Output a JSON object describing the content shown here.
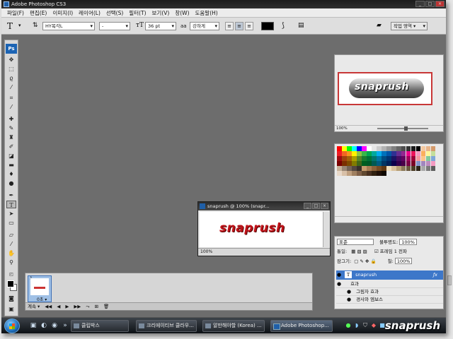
{
  "window": {
    "title": "Adobe Photoshop CS3",
    "controls": [
      "_",
      "□",
      "×"
    ]
  },
  "menu": [
    "파일(F)",
    "편집(E)",
    "이미지(I)",
    "레이어(L)",
    "선택(S)",
    "필터(T)",
    "보기(V)",
    "창(W)",
    "도움말(H)"
  ],
  "options": {
    "tool_glyph": "T",
    "font_family": "HY목각L",
    "font_style": "-",
    "font_size": "36 pt",
    "aa_label": "aa",
    "antialias": "강하게",
    "workspace_label": "작업 영역 ▾",
    "text_color": "#000000"
  },
  "document": {
    "title": "snaprush @ 100% (snapr...",
    "zoom_status": "100%",
    "text": "snaprush",
    "text_color": "#c0141a",
    "controls": [
      "_",
      "□",
      "×"
    ]
  },
  "navigator": {
    "preview_text": "snaprush",
    "zoom": "100%"
  },
  "swatches": {
    "colors": [
      "#ff0000",
      "#ffff00",
      "#00ff00",
      "#00ffff",
      "#0000ff",
      "#ff00ff",
      "#ffffff",
      "#e6e6e6",
      "#cccccc",
      "#b3b3b3",
      "#999999",
      "#808080",
      "#666666",
      "#4d4d4d",
      "#333333",
      "#1a1a1a",
      "#000000",
      "#f4c9a0",
      "#e8b48a",
      "#d49a6a",
      "#ed1c24",
      "#f26522",
      "#f7941d",
      "#fff200",
      "#8dc63f",
      "#39b54a",
      "#00a651",
      "#00a99d",
      "#00aeef",
      "#0072bc",
      "#0054a6",
      "#2e3192",
      "#662d91",
      "#92278f",
      "#ec008c",
      "#ed145b",
      "#f49ac1",
      "#fbaf5d",
      "#fff799",
      "#c4df9b",
      "#9e0b0f",
      "#a0410d",
      "#a3620a",
      "#aba000",
      "#598527",
      "#1a7b30",
      "#007236",
      "#00746b",
      "#0076a3",
      "#004b80",
      "#003471",
      "#1b1464",
      "#440e62",
      "#630460",
      "#9e005d",
      "#9e0039",
      "#f6989d",
      "#fdc689",
      "#82ca9c",
      "#7ea7d8",
      "#790000",
      "#7b2e00",
      "#7d4900",
      "#827b00",
      "#406618",
      "#005e20",
      "#005826",
      "#005952",
      "#005b7f",
      "#003663",
      "#002157",
      "#0d004c",
      "#32004b",
      "#4b0049",
      "#7b0046",
      "#7a0026",
      "#8493ca",
      "#a186be",
      "#bd8cbf",
      "#f49ac2",
      "#c7b299",
      "#998675",
      "#736357",
      "#534741",
      "#37302a",
      "#c69c6d",
      "#a67c52",
      "#8c6239",
      "#754c24",
      "#603913",
      "#f0e0c0",
      "#d9c2a0",
      "#b8a078",
      "#8c7a5a",
      "#6b5a40",
      "#4d3e28",
      "#2e2418",
      "#a8a8a8",
      "#7a7a7a",
      "#5c5c5c",
      "#e8d8c8",
      "#d8c0a8",
      "#c0a080",
      "#a08060",
      "#806048",
      "#604830",
      "#483020",
      "#302010",
      "#201008",
      "#100800"
    ]
  },
  "layers": {
    "blend_mode": "표준",
    "opacity_label": "불투명도:",
    "opacity": "100%",
    "unify_label": "통일:",
    "propagate_label": "프레임 1 전파",
    "lock_label": "잠그기:",
    "fill_label": "칠:",
    "fill": "100%",
    "text_layer": "snaprush",
    "text_layer_icon": "T",
    "effects_label": "효과",
    "effect_items": [
      "그림자 효과",
      "경사와 엠보스"
    ]
  },
  "animation": {
    "frame_duration": "0초 ▾",
    "loop": "계속",
    "controls": [
      "◀◀",
      "◀",
      "▶",
      "▶▶",
      "⤳",
      "⊞",
      "🗑"
    ]
  },
  "taskbar": {
    "buttons": [
      "클립박스",
      "크리에이티브 클라우...",
      "알만해야할 (Korea) ...",
      "Adobe Photoshop..."
    ],
    "brand": "snaprush"
  }
}
